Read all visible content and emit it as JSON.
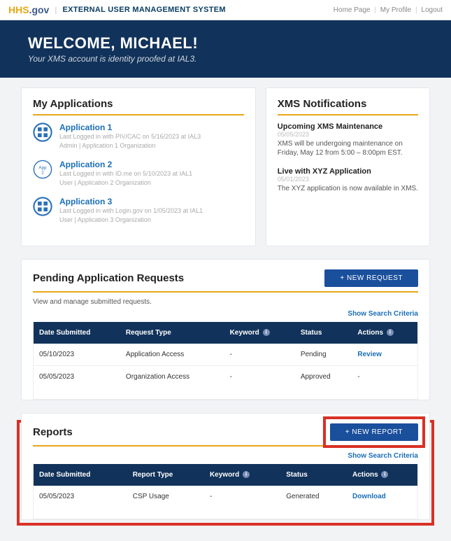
{
  "topbar": {
    "logo_hhs": "HHS",
    "logo_gov": ".gov",
    "system_name": "EXTERNAL USER MANAGEMENT SYSTEM",
    "nav_home": "Home Page",
    "nav_profile": "My Profile",
    "nav_logout": "Logout"
  },
  "welcome": {
    "heading": "WELCOME, MICHAEL!",
    "subtext": "Your XMS account is identity proofed at IAL3."
  },
  "my_apps": {
    "title": "My Applications",
    "items": [
      {
        "name": "Application 1",
        "meta1": "Last Logged in with PIV/CAC on 5/16/2023 at IAL3",
        "meta2": "Admin | Application 1 Organization"
      },
      {
        "name": "Application 2",
        "meta1": "Last Logged in with ID.me on 5/10/2023 at IAL1",
        "meta2": "User | Application 2 Organization",
        "badge": "App 2"
      },
      {
        "name": "Application 3",
        "meta1": "Last Logged in with Login.gov on 1/05/2023 at IAL1",
        "meta2": "User | Application 3 Organization"
      }
    ]
  },
  "notifications": {
    "title": "XMS Notifications",
    "items": [
      {
        "title": "Upcoming XMS Maintenance",
        "date": "05/05/2023",
        "body": "XMS will be undergoing maintenance on Friday, May 12 from 5:00 – 8:00pm EST."
      },
      {
        "title": "Live with XYZ Application",
        "date": "05/01/2023",
        "body": "The XYZ application is now available in XMS."
      }
    ]
  },
  "pending": {
    "title": "Pending Application Requests",
    "button": "+ NEW REQUEST",
    "subtext": "View and manage submitted requests.",
    "search": "Show Search Criteria",
    "columns": {
      "c1": "Date Submitted",
      "c2": "Request Type",
      "c3": "Keyword",
      "c4": "Status",
      "c5": "Actions"
    },
    "rows": [
      {
        "date": "05/10/2023",
        "type": "Application Access",
        "keyword": "-",
        "status": "Pending",
        "action": "Review"
      },
      {
        "date": "05/05/2023",
        "type": "Organization Access",
        "keyword": "-",
        "status": "Approved",
        "action": "-"
      }
    ]
  },
  "reports": {
    "title": "Reports",
    "button": "+ NEW REPORT",
    "search": "Show Search Criteria",
    "columns": {
      "c1": "Date Submitted",
      "c2": "Report Type",
      "c3": "Keyword",
      "c4": "Status",
      "c5": "Actions"
    },
    "rows": [
      {
        "date": "05/05/2023",
        "type": "CSP Usage",
        "keyword": "-",
        "status": "Generated",
        "action": "Download"
      }
    ]
  }
}
